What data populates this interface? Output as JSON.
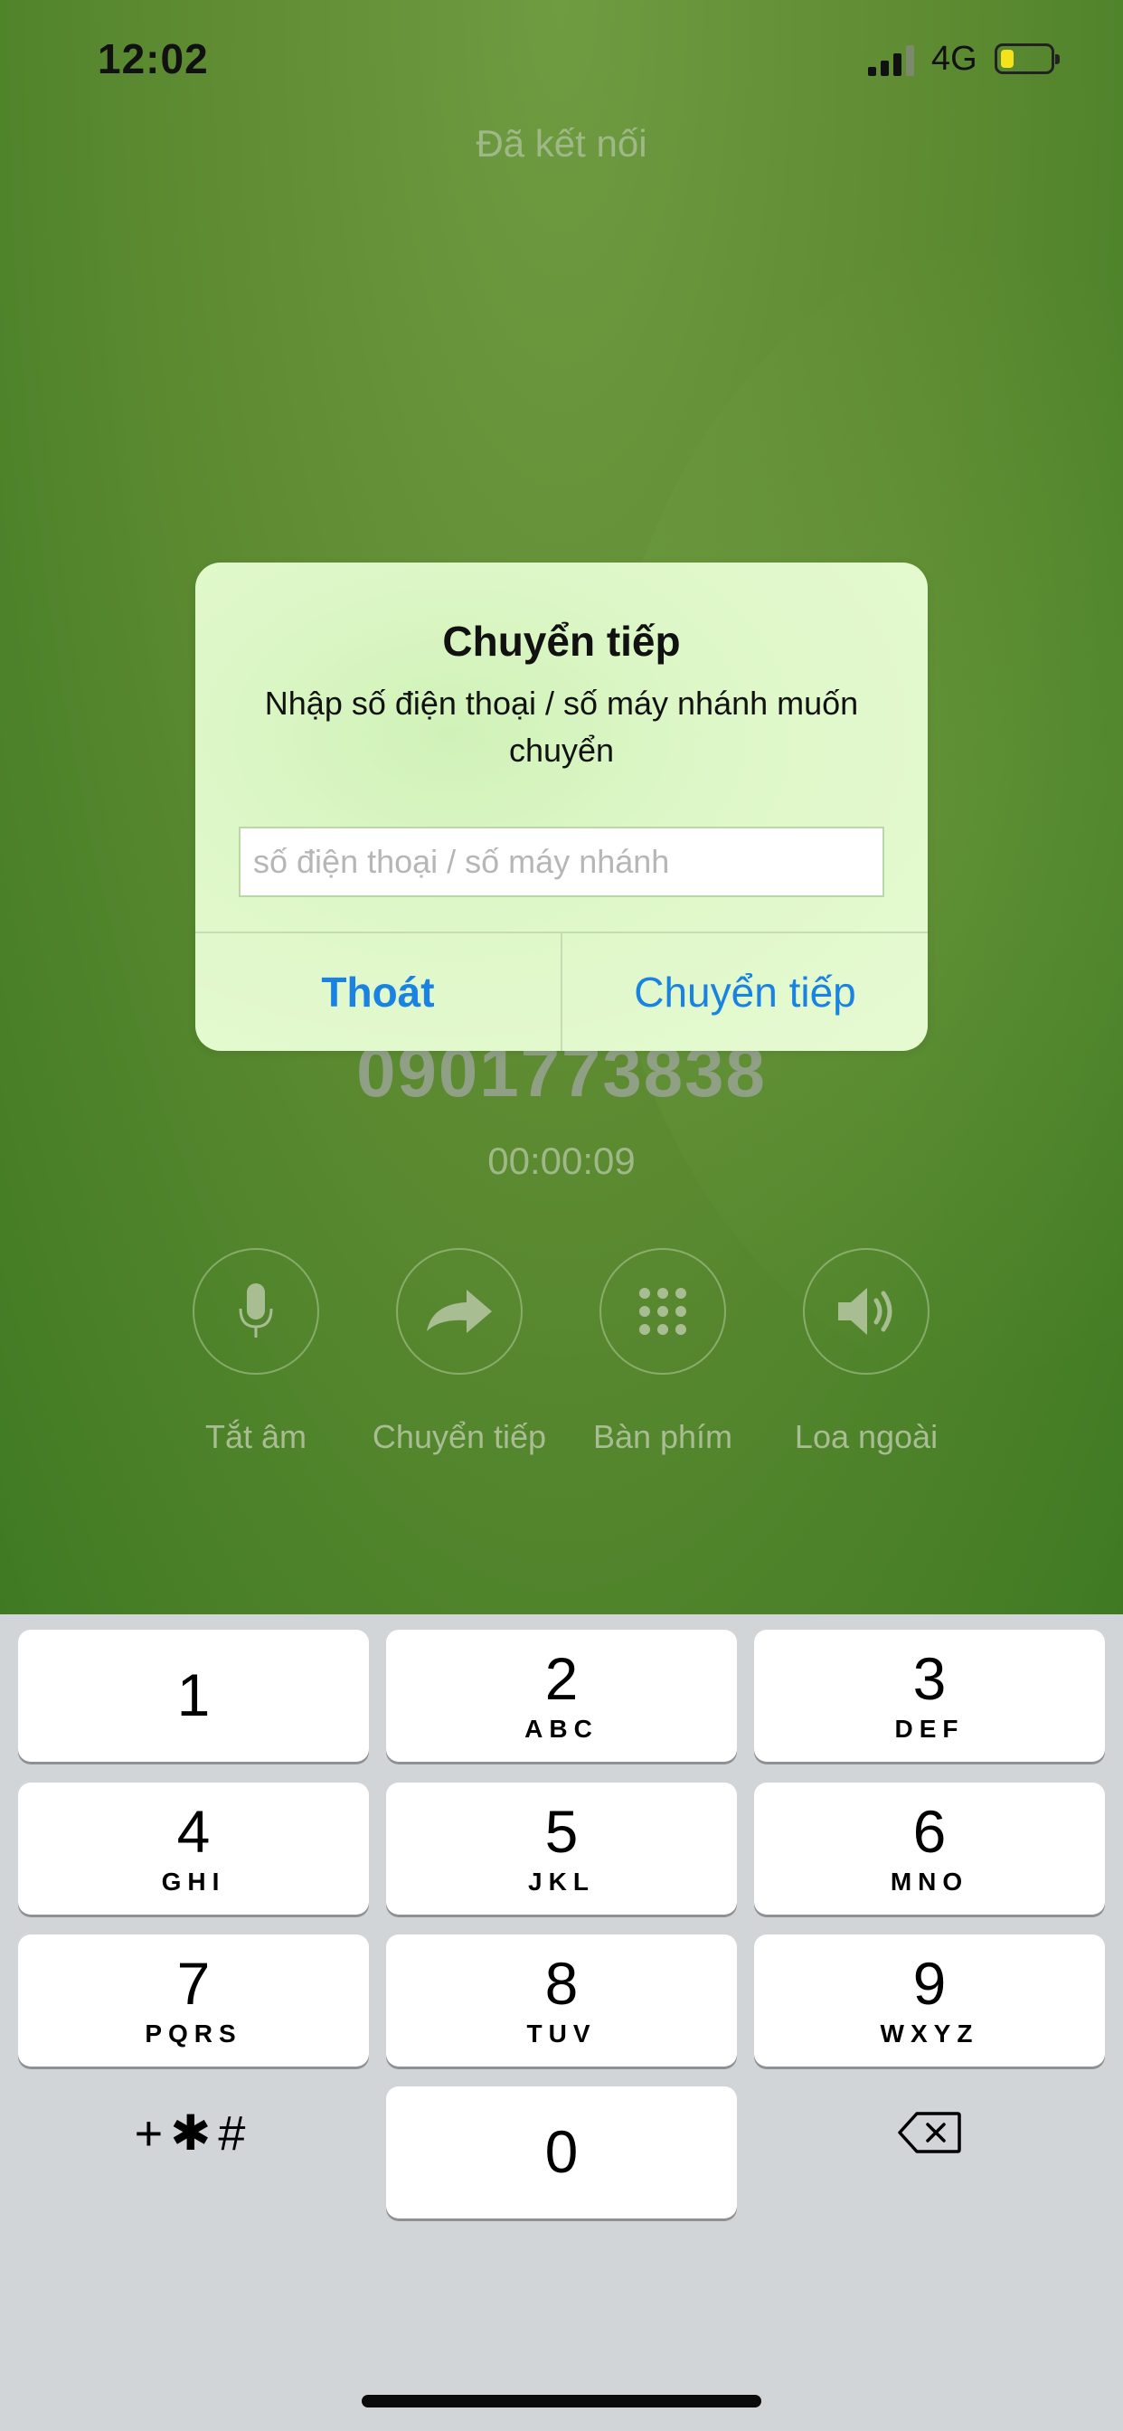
{
  "status_bar": {
    "time": "12:02",
    "network": "4G",
    "battery_level": 0.25,
    "battery_color": "#f5e21b"
  },
  "call": {
    "status": "Đã kết nối",
    "number": "0901773838",
    "duration": "00:00:09",
    "actions": [
      {
        "label": "Tắt âm",
        "icon": "microphone-icon"
      },
      {
        "label": "Chuyển tiếp",
        "icon": "forward-arrow-icon"
      },
      {
        "label": "Bàn phím",
        "icon": "keypad-grid-icon"
      },
      {
        "label": "Loa ngoài",
        "icon": "speaker-icon"
      }
    ]
  },
  "dialog": {
    "title": "Chuyển tiếp",
    "message": "Nhập số điện thoại / số máy nhánh muốn chuyển",
    "input_placeholder": "số điện thoại / số máy nhánh",
    "input_value": "",
    "cancel_label": "Thoát",
    "confirm_label": "Chuyển tiếp",
    "button_color": "#1a82e0"
  },
  "keypad": {
    "keys": [
      {
        "digit": "1",
        "letters": ""
      },
      {
        "digit": "2",
        "letters": "ABC"
      },
      {
        "digit": "3",
        "letters": "DEF"
      },
      {
        "digit": "4",
        "letters": "GHI"
      },
      {
        "digit": "5",
        "letters": "JKL"
      },
      {
        "digit": "6",
        "letters": "MNO"
      },
      {
        "digit": "7",
        "letters": "PQRS"
      },
      {
        "digit": "8",
        "letters": "TUV"
      },
      {
        "digit": "9",
        "letters": "WXYZ"
      },
      {
        "digit": "0",
        "letters": ""
      }
    ],
    "symbols": "+✱#",
    "backspace_icon": "backspace-icon"
  }
}
